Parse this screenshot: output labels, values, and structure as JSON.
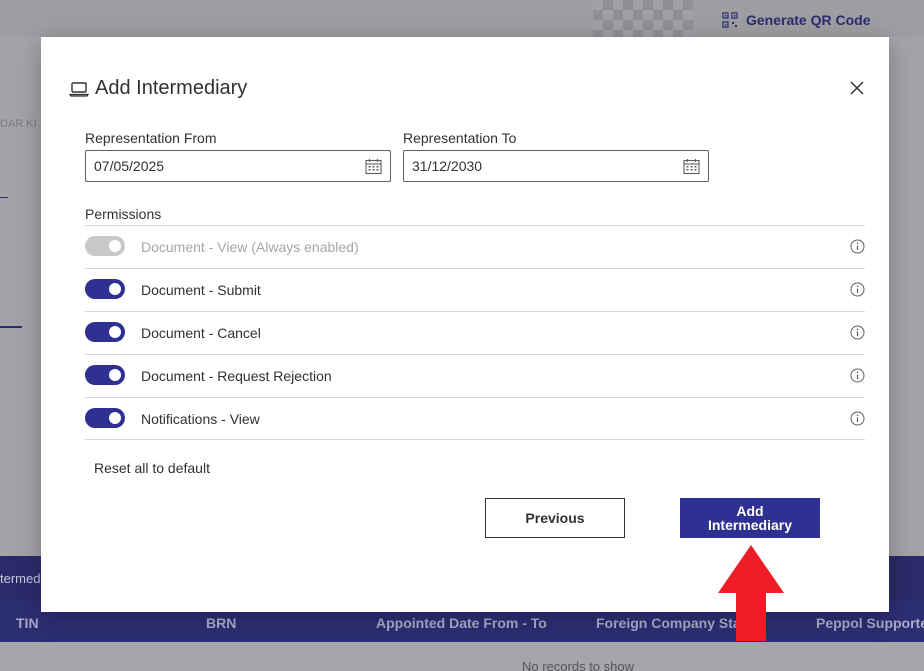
{
  "background": {
    "qr_label": "Generate QR Code",
    "left_label": "DAR KI",
    "banner_text": "termed",
    "table_columns": [
      "TIN",
      "BRN",
      "Appointed Date From - To",
      "Foreign Company Sta",
      "Peppol Supporte"
    ],
    "no_records": "No records to show"
  },
  "modal": {
    "title": "Add Intermediary",
    "icon": "laptop-icon",
    "representation_from": {
      "label": "Representation From",
      "value": "07/05/2025"
    },
    "representation_to": {
      "label": "Representation To",
      "value": "31/12/2030"
    },
    "permissions_label": "Permissions",
    "permissions": [
      {
        "label": "Document - View (Always enabled)",
        "enabled": true,
        "disabled": true
      },
      {
        "label": "Document - Submit",
        "enabled": true,
        "disabled": false
      },
      {
        "label": "Document - Cancel",
        "enabled": true,
        "disabled": false
      },
      {
        "label": "Document - Request Rejection",
        "enabled": true,
        "disabled": false
      },
      {
        "label": "Notifications - View",
        "enabled": true,
        "disabled": false
      }
    ],
    "reset_label": "Reset all to default",
    "previous_label": "Previous",
    "add_label": "Add Intermediary"
  },
  "colors": {
    "accent": "#2e3192",
    "overlay_banner": "#2a2c6a",
    "arrow": "#ee1c25"
  }
}
